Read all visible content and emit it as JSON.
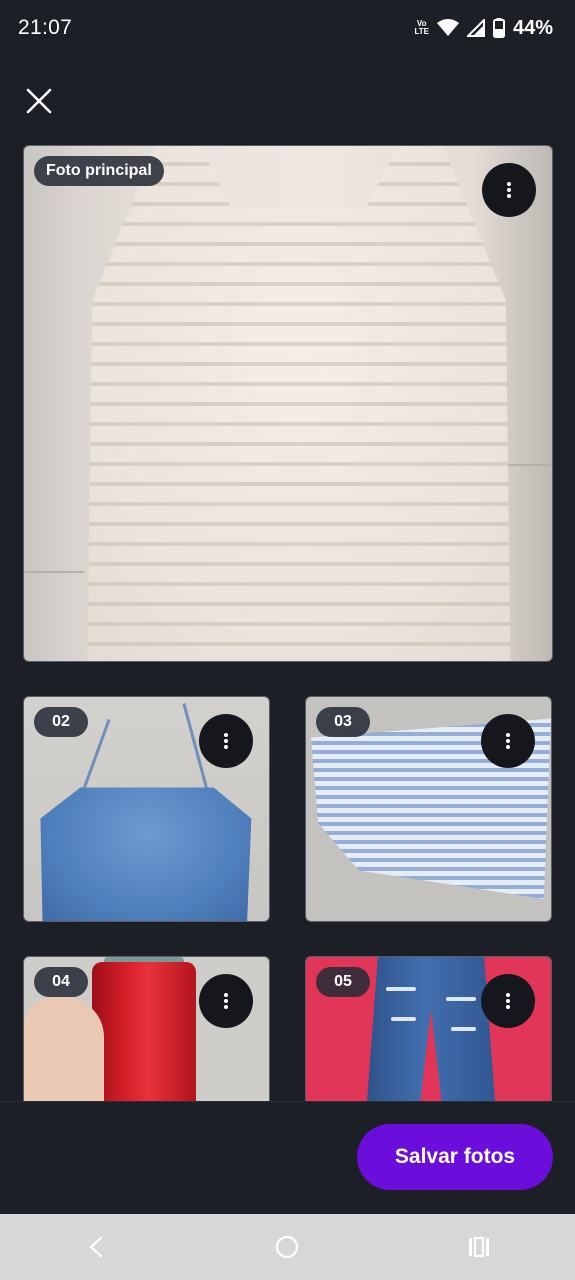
{
  "status_bar": {
    "time": "21:07",
    "volte_top": "Vo",
    "volte_bottom": "LTE",
    "battery": "44%",
    "icons": [
      "wifi-icon",
      "signal-icon",
      "battery-icon"
    ]
  },
  "toolbar": {
    "close_icon": "close-icon"
  },
  "photos": {
    "main_label": "Foto principal",
    "items": [
      {
        "label": "02"
      },
      {
        "label": "03"
      },
      {
        "label": "04"
      },
      {
        "label": "05"
      }
    ],
    "menu_icon": "more-vert-icon"
  },
  "actions": {
    "save_label": "Salvar fotos"
  },
  "nav": {
    "icons": [
      "back-icon",
      "home-icon",
      "recents-icon"
    ]
  },
  "colors": {
    "background": "#1c1f26",
    "accent": "#6c0edb",
    "nav_bar": "#d7d7d9"
  }
}
